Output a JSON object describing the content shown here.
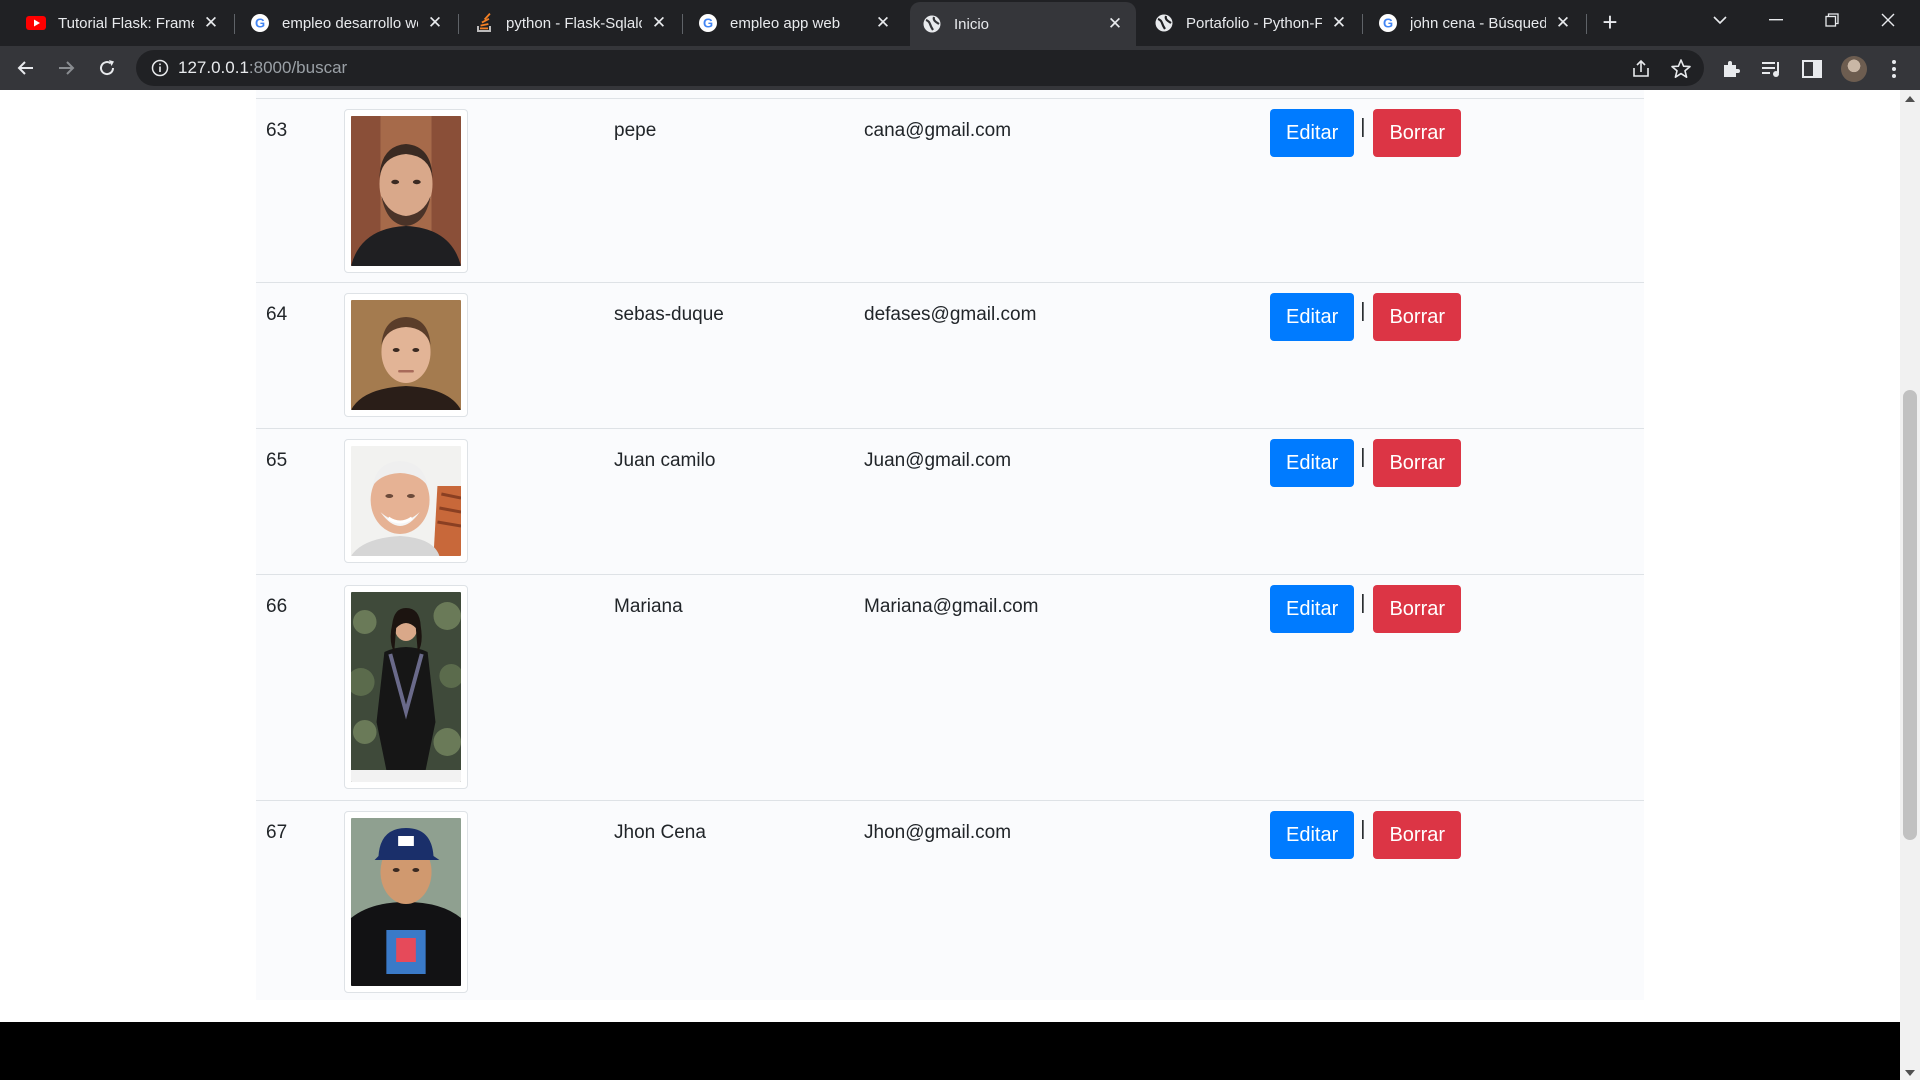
{
  "browser": {
    "tabs": [
      {
        "title": "Tutorial Flask: Framew",
        "favicon": "youtube-icon"
      },
      {
        "title": "empleo desarrollo we",
        "favicon": "google-icon"
      },
      {
        "title": "python - Flask-Sqlalch",
        "favicon": "stackoverflow-icon"
      },
      {
        "title": "empleo app web",
        "favicon": "google-icon"
      },
      {
        "title": "Inicio",
        "favicon": "globe-icon",
        "active": true
      },
      {
        "title": "Portafolio - Python-Fl",
        "favicon": "globe-icon"
      },
      {
        "title": "john cena - Búsqueda",
        "favicon": "google-icon"
      }
    ],
    "address": {
      "host": "127.0.0.1",
      "path": ":8000/buscar"
    }
  },
  "table": {
    "rows": [
      {
        "id": "63",
        "name": "pepe",
        "email": "cana@gmail.com",
        "photo": "photo-man-beard"
      },
      {
        "id": "64",
        "name": "sebas-duque",
        "email": "defases@gmail.com",
        "photo": "photo-man-short-hair"
      },
      {
        "id": "65",
        "name": "Juan camilo",
        "email": "Juan@gmail.com",
        "photo": "photo-old-man"
      },
      {
        "id": "66",
        "name": "Mariana",
        "email": "Mariana@gmail.com",
        "photo": "photo-woman"
      },
      {
        "id": "67",
        "name": "Jhon Cena",
        "email": "Jhon@gmail.com",
        "photo": "photo-man-cap"
      }
    ],
    "edit_label": "Editar",
    "delete_label": "Borrar",
    "separator": "|"
  },
  "colors": {
    "edit": "#007bff",
    "delete": "#dc3545"
  }
}
